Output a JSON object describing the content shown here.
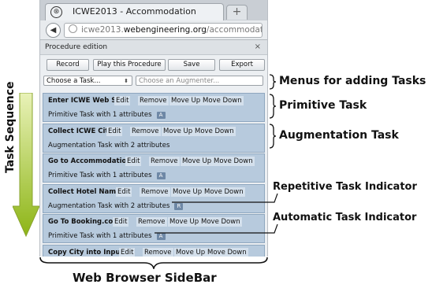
{
  "browser": {
    "tab_title": "ICWE2013 - Accommodation",
    "new_tab_symbol": "+",
    "url_prefix": "icwe2013.",
    "url_domain": "webengineering.org",
    "url_path": "/accommodation",
    "back_symbol": "◀"
  },
  "panel": {
    "title": "Procedure edition",
    "close_symbol": "×",
    "toolbar": {
      "record": "Record",
      "play": "Play this Procedure",
      "save": "Save",
      "export": "Export"
    },
    "task_select": "Choose a Task...",
    "augmenter_placeholder": "Choose an Augmenter...",
    "task_buttons": {
      "edit": "Edit",
      "remove": "Remove",
      "move_up": "Move Up",
      "move_down": "Move Down"
    },
    "tasks": [
      {
        "name": "Enter ICWE Web Site",
        "desc": "Primitive Task with 1 attributes",
        "badge": "A"
      },
      {
        "name": "Collect ICWE City",
        "desc": "Augmentation Task with 2 attributes",
        "badge": ""
      },
      {
        "name": "Go to Accommodation",
        "desc": "Primitive Task with 1 attributes",
        "badge": "A"
      },
      {
        "name": "Collect Hotel Name",
        "desc": "Augmentation Task with 2 attributes",
        "badge": "R"
      },
      {
        "name": "Go To Booking.com",
        "desc": "Primitive Task with 1 attributes",
        "badge": "A"
      },
      {
        "name": "Copy City into Input",
        "desc": "",
        "badge": ""
      }
    ]
  },
  "annotations": {
    "menus": "Menus for adding Tasks",
    "primitive": "Primitive Task",
    "augmentation": "Augmentation Task",
    "repetitive": "Repetitive Task Indicator",
    "automatic": "Automatic Task Indicator",
    "sequence": "Task Sequence",
    "sidebar": "Web Browser SideBar"
  },
  "colors": {
    "task_bg": "#b7cadd",
    "arrow_green": "#8db516"
  }
}
